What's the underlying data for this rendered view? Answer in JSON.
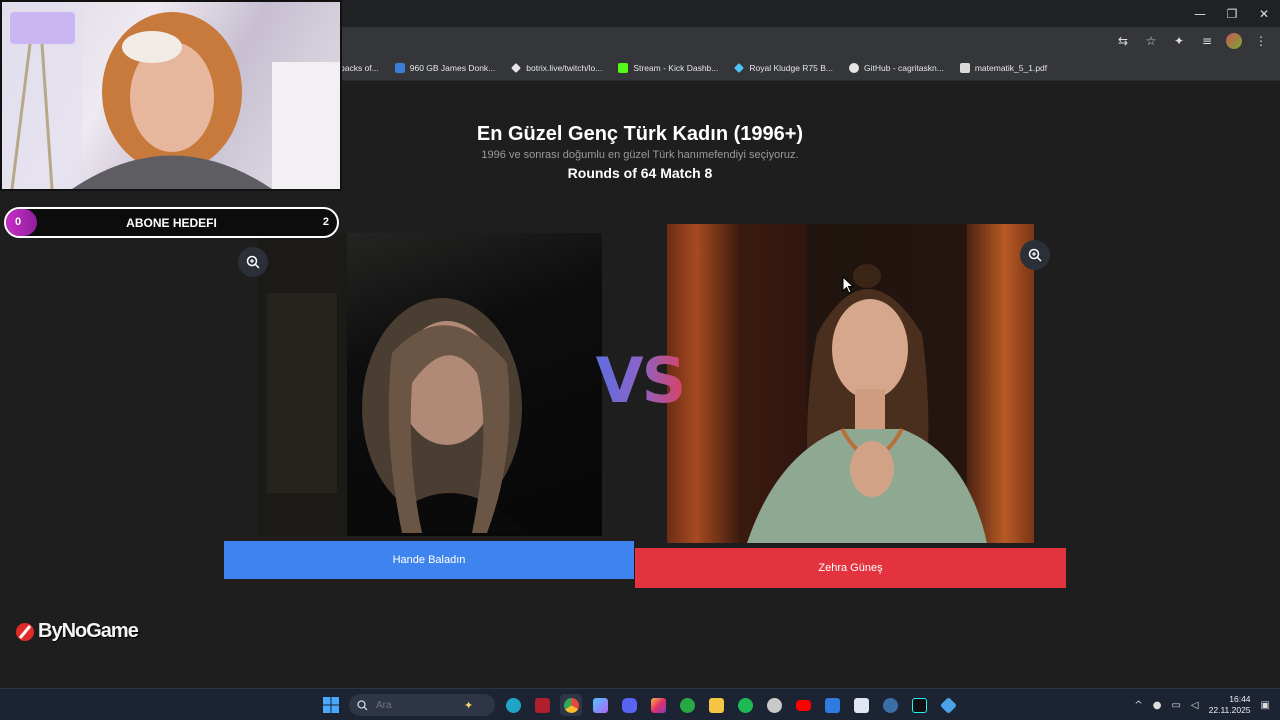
{
  "browser": {
    "bookmarks": [
      {
        "label": "packs of...",
        "icon": "bookmark-icon",
        "color": "#35363a"
      },
      {
        "label": "960 GB James Donk...",
        "icon": "hb-icon",
        "color": "#3b7dd8"
      },
      {
        "label": "botrix.live/twitch/lo...",
        "icon": "diamond-icon",
        "color": "#e6e6e6"
      },
      {
        "label": "Stream - Kick Dashb...",
        "icon": "kick-icon",
        "color": "#53fc18"
      },
      {
        "label": "Royal Kludge R75 B...",
        "icon": "gem-icon",
        "color": "#4fc3f7"
      },
      {
        "label": "GitHub - cagritaskn...",
        "icon": "github-icon",
        "color": "#e6e6e6"
      },
      {
        "label": "matematik_5_1.pdf",
        "icon": "file-icon",
        "color": "#dadada"
      }
    ],
    "window_controls": [
      "—",
      "❐",
      "✕"
    ]
  },
  "page": {
    "title": "En Güzel Genç Türk Kadın (1996+)",
    "subtitle": "1996 ve sonrası doğumlu en güzel Türk hanımefendiyi seçiyoruz.",
    "round": "Rounds of 64 Match 8",
    "vs_label": "VS",
    "left": {
      "name": "Hande Baladın",
      "button_color": "#3f83ee"
    },
    "right": {
      "name": "Zehra Güneş",
      "button_color": "#e2333f"
    }
  },
  "overlay": {
    "goal": {
      "start": "0",
      "label": "ABONE HEDEFI",
      "target": "2",
      "progress": 0
    },
    "logo": "ByNoGame"
  },
  "taskbar": {
    "search_placeholder": "Ara",
    "time": "16:44",
    "date": "22.11.2025",
    "apps": [
      {
        "name": "start-icon",
        "color": "#4aa8ff"
      },
      {
        "name": "edge-icon",
        "color": "#1fa3c8"
      },
      {
        "name": "app-red-icon",
        "color": "#b01f2e"
      },
      {
        "name": "chrome-icon",
        "color": "#e8453c"
      },
      {
        "name": "copilot-icon",
        "color": "#8f7bff"
      },
      {
        "name": "discord-icon",
        "color": "#5865f2"
      },
      {
        "name": "instagram-icon",
        "color": "#e1306c"
      },
      {
        "name": "xbox-icon",
        "color": "#27a844"
      },
      {
        "name": "folder-icon",
        "color": "#f5c544"
      },
      {
        "name": "spotify-icon",
        "color": "#1db954"
      },
      {
        "name": "github-desktop-icon",
        "color": "#c9c9c9"
      },
      {
        "name": "youtube-icon",
        "color": "#ff0000"
      },
      {
        "name": "mail-icon",
        "color": "#2f7be0"
      },
      {
        "name": "notepad-icon",
        "color": "#dfe6f2"
      },
      {
        "name": "steam-icon",
        "color": "#3a6ea5"
      },
      {
        "name": "tiktok-icon",
        "color": "#111111"
      },
      {
        "name": "settings-icon",
        "color": "#49a3e6"
      }
    ]
  }
}
